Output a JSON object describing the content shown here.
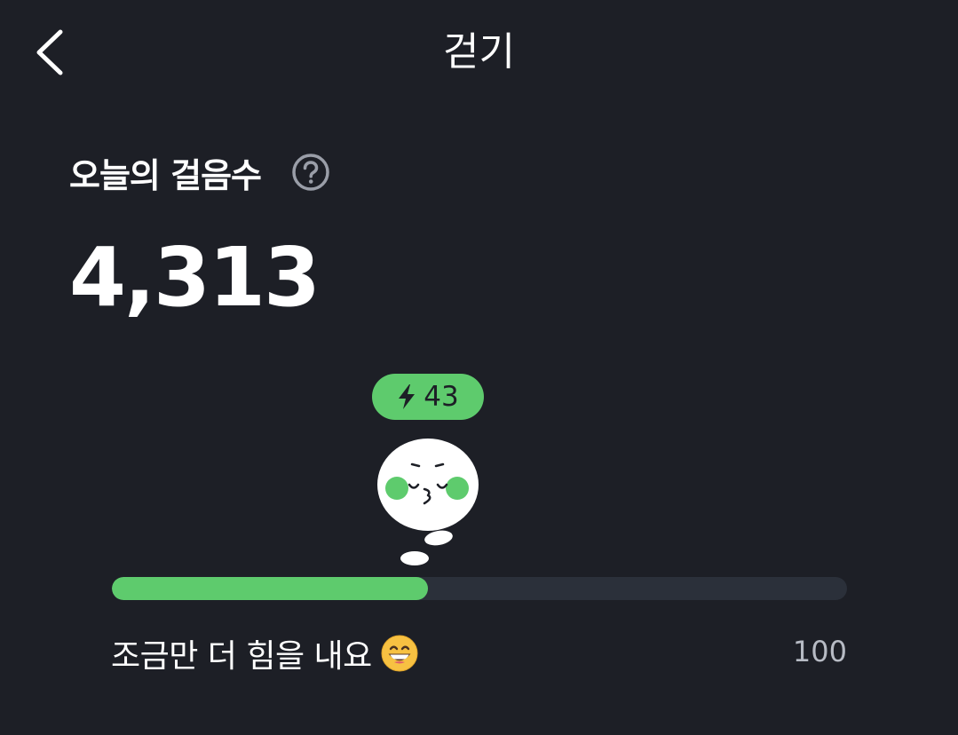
{
  "header": {
    "title": "걷기",
    "back_icon": "chevron-left-icon"
  },
  "steps": {
    "label": "오늘의 걸음수",
    "help_icon": "question-circle-icon",
    "count": "4,313"
  },
  "reward": {
    "icon": "lightning-bolt-icon",
    "points": "43"
  },
  "mascot": {
    "icon": "kissing-face-character"
  },
  "progress": {
    "fraction": 0.43,
    "message": "조금만 더 힘을 내요",
    "emoji": "grinning-face-emoji",
    "goal": "100"
  },
  "colors": {
    "background": "#1d1f26",
    "accent": "#5ecb6d",
    "track": "#2b303a",
    "muted_text": "#b7bbc4"
  }
}
